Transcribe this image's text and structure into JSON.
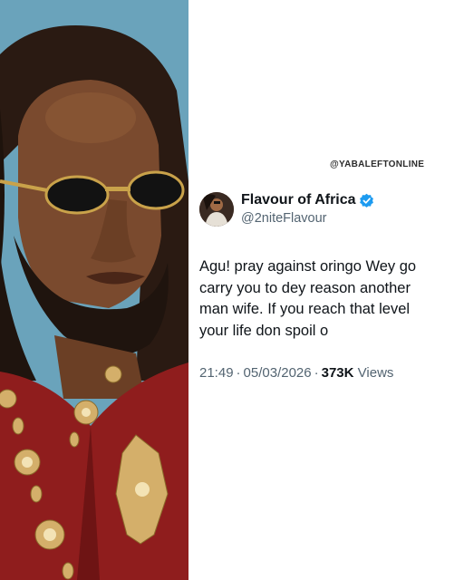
{
  "watermark": "@YABALEFTONLINE",
  "tweet": {
    "display_name": "Flavour of Africa",
    "handle": "@2niteFlavour",
    "text": "Agu! pray against oringo Wey go\ncarry you to dey reason another\nman wife. If you reach that level\nyour life don spoil o",
    "time": "21:49",
    "date": "05/03/2026",
    "separator": "·",
    "views_count": "373K",
    "views_label": "Views"
  },
  "icons": {
    "verified": "verified-badge-icon",
    "avatar": "profile-avatar"
  },
  "colors": {
    "verified_blue": "#1d9bf0",
    "text_primary": "#0f1419",
    "text_secondary": "#536471"
  }
}
